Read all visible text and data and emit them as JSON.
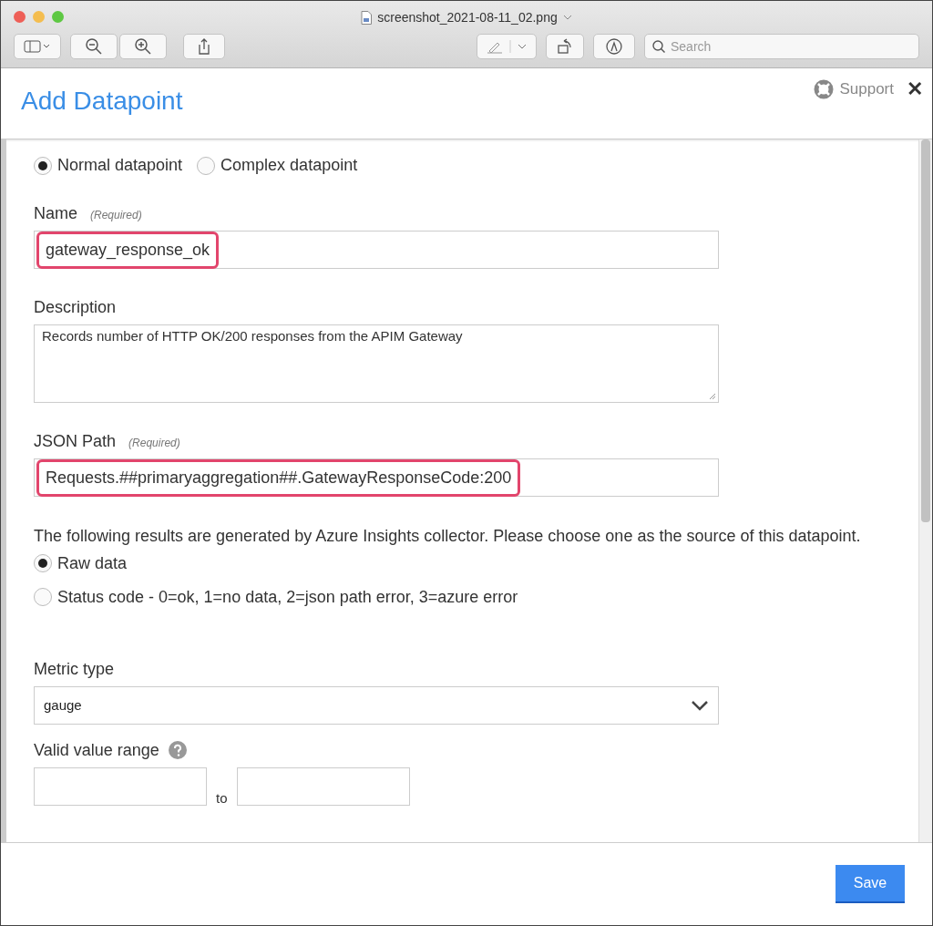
{
  "window": {
    "title": "screenshot_2021-08-11_02.png",
    "search": {
      "placeholder": "Search"
    }
  },
  "dialog": {
    "title": "Add Datapoint",
    "support": "Support",
    "close": "✕"
  },
  "datapoint_type": [
    {
      "label": "Normal datapoint",
      "selected": true
    },
    {
      "label": "Complex datapoint",
      "selected": false
    }
  ],
  "name": {
    "label": "Name",
    "hint": "(Required)",
    "value": "gateway_response_ok",
    "highlighted": true
  },
  "description": {
    "label": "Description",
    "value": "Records number of HTTP OK/200 responses from the APIM Gateway"
  },
  "json_path": {
    "label": "JSON Path",
    "hint": "(Required)",
    "value": "Requests.##primaryaggregation##.GatewayResponseCode:200",
    "highlighted": true
  },
  "source_note": "The following results are generated by Azure Insights collector. Please choose one as the source of this datapoint.",
  "source": [
    {
      "label": "Raw data",
      "selected": true
    },
    {
      "label": "Status code - 0=ok, 1=no data, 2=json path error, 3=azure error",
      "selected": false
    }
  ],
  "metric_type": {
    "label": "Metric type",
    "value": "gauge"
  },
  "valid_range": {
    "label": "Valid value range",
    "separator": "to"
  },
  "save": "Save"
}
